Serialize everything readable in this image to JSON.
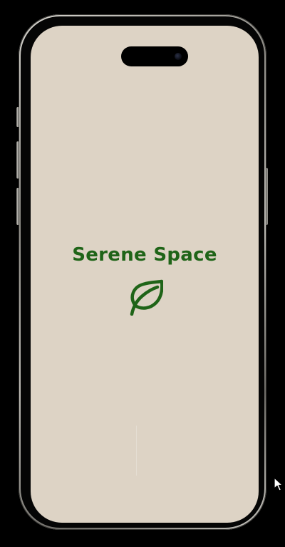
{
  "app": {
    "title": "Serene Space",
    "logo_icon": "leaf-icon"
  },
  "colors": {
    "background": "#000000",
    "screen_background": "#ddd3c5",
    "brand_green": "#1f6418",
    "frame_metal": "#bdbbb5"
  },
  "device": {
    "icons": [
      "dynamic-island",
      "mouse-cursor-icon"
    ]
  }
}
